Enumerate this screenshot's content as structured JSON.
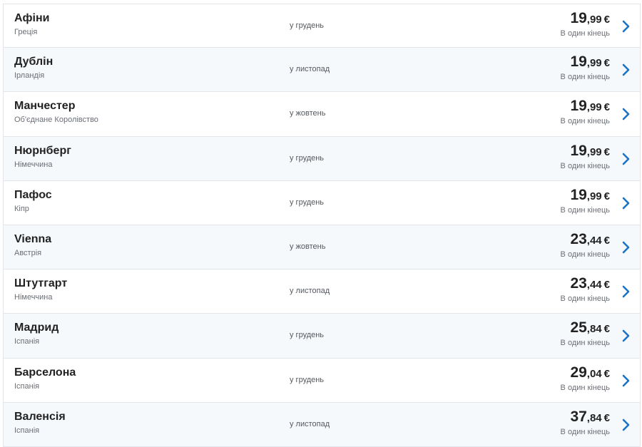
{
  "destinations": [
    {
      "city": "Афіни",
      "country": "Греція",
      "month": "у грудень",
      "price_whole": "19",
      "price_cents": ",99",
      "currency": "€",
      "fare_type": "В один кінець"
    },
    {
      "city": "Дублін",
      "country": "Ірландія",
      "month": "у листопад",
      "price_whole": "19",
      "price_cents": ",99",
      "currency": "€",
      "fare_type": "В один кінець"
    },
    {
      "city": "Манчестер",
      "country": "Об'єднане Королівство",
      "month": "у жовтень",
      "price_whole": "19",
      "price_cents": ",99",
      "currency": "€",
      "fare_type": "В один кінець"
    },
    {
      "city": "Нюрнберг",
      "country": "Німеччина",
      "month": "у грудень",
      "price_whole": "19",
      "price_cents": ",99",
      "currency": "€",
      "fare_type": "В один кінець"
    },
    {
      "city": "Пафос",
      "country": "Кіпр",
      "month": "у грудень",
      "price_whole": "19",
      "price_cents": ",99",
      "currency": "€",
      "fare_type": "В один кінець"
    },
    {
      "city": "Vienna",
      "country": "Австрія",
      "month": "у жовтень",
      "price_whole": "23",
      "price_cents": ",44",
      "currency": "€",
      "fare_type": "В один кінець"
    },
    {
      "city": "Штутгарт",
      "country": "Німеччина",
      "month": "у листопад",
      "price_whole": "23",
      "price_cents": ",44",
      "currency": "€",
      "fare_type": "В один кінець"
    },
    {
      "city": "Мадрид",
      "country": "Іспанія",
      "month": "у грудень",
      "price_whole": "25",
      "price_cents": ",84",
      "currency": "€",
      "fare_type": "В один кінець"
    },
    {
      "city": "Барселона",
      "country": "Іспанія",
      "month": "у грудень",
      "price_whole": "29",
      "price_cents": ",04",
      "currency": "€",
      "fare_type": "В один кінець"
    },
    {
      "city": "Валенсія",
      "country": "Іспанія",
      "month": "у листопад",
      "price_whole": "37",
      "price_cents": ",84",
      "currency": "€",
      "fare_type": "В один кінець"
    }
  ],
  "icons": {
    "row_action": "chevron-right-icon"
  },
  "colors": {
    "accent": "#1a73c8",
    "alt_row": "#f6f9fc",
    "border": "#e2e5ea"
  }
}
